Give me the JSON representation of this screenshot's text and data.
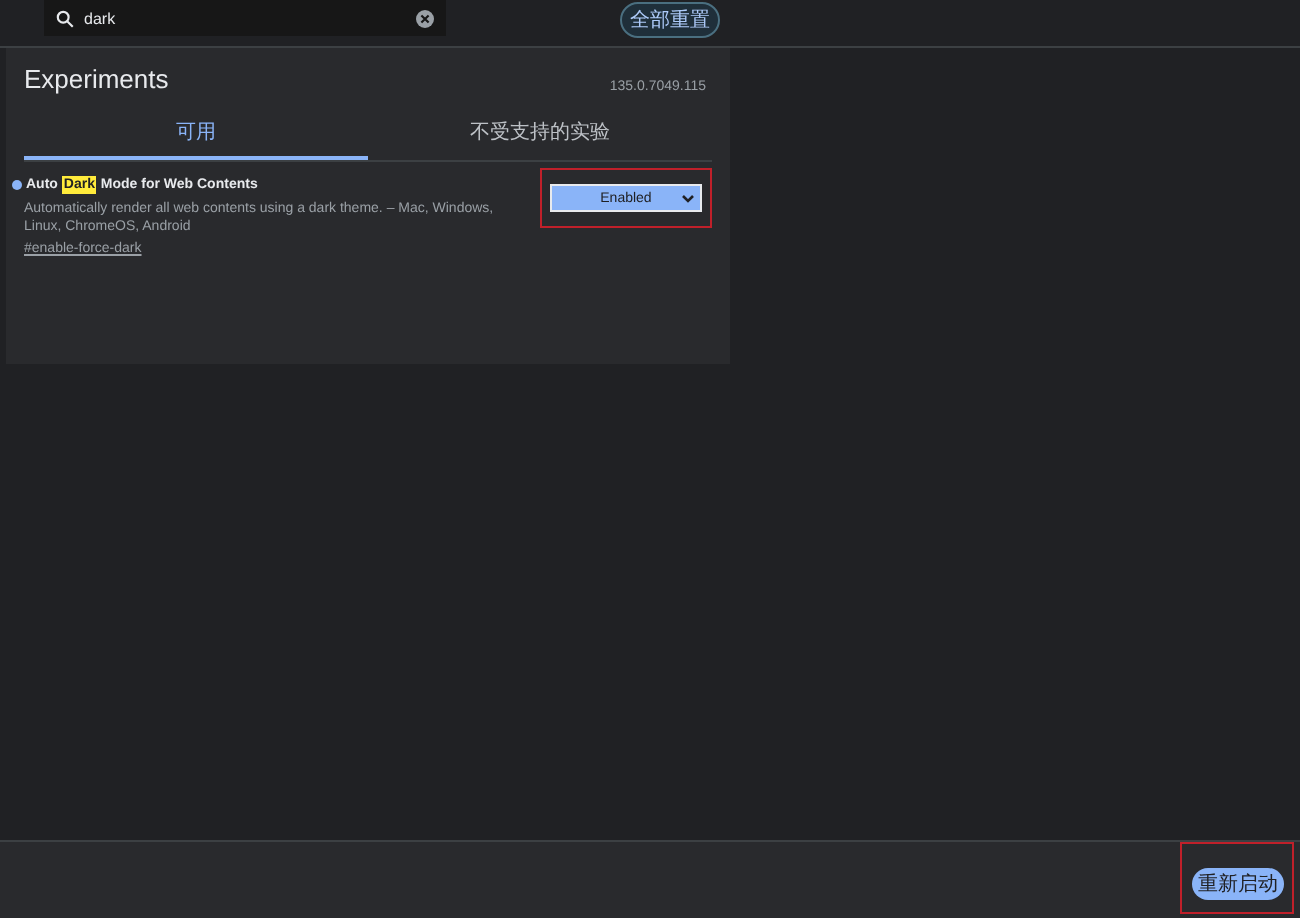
{
  "search": {
    "value": "dark"
  },
  "reset_button": {
    "label": "全部重置"
  },
  "title": "Experiments",
  "version": "135.0.7049.115",
  "tabs": [
    {
      "label": "可用",
      "selected": true
    },
    {
      "label": "不受支持的实验",
      "selected": false
    }
  ],
  "experiments": [
    {
      "title": "Auto **Dark** Mode for Web Contents",
      "description": "Automatically render all web contents using a dark theme. – Mac, Windows, Linux, ChromeOS, Android",
      "link": "#enable-force-dark",
      "select": "Enabled",
      "highlighted": true
    }
  ],
  "relaunch_button": {
    "label": "重新启动",
    "highlighted": true
  }
}
